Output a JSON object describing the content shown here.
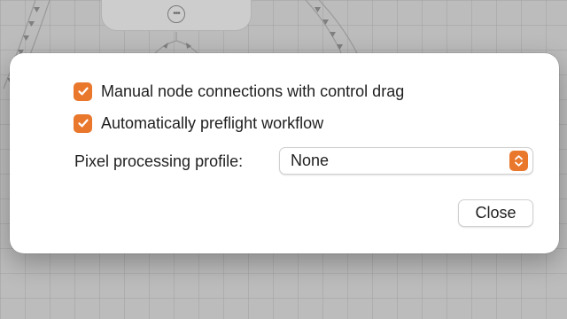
{
  "dialog": {
    "manual_connections": {
      "label": "Manual node connections with control drag",
      "checked": true
    },
    "auto_preflight": {
      "label": "Automatically preflight workflow",
      "checked": true
    },
    "pixel_profile": {
      "label": "Pixel processing profile:",
      "value": "None"
    },
    "close_label": "Close"
  },
  "colors": {
    "accent": "#e9772c",
    "sheet_background": "#ffffff",
    "dimmed_canvas": "#bcbcbc"
  },
  "icons": {
    "node_menu": "ellipsis-circle-icon",
    "checkbox_checked": "checkmark-icon",
    "select_stepper": "chevron-up-down-icon"
  }
}
